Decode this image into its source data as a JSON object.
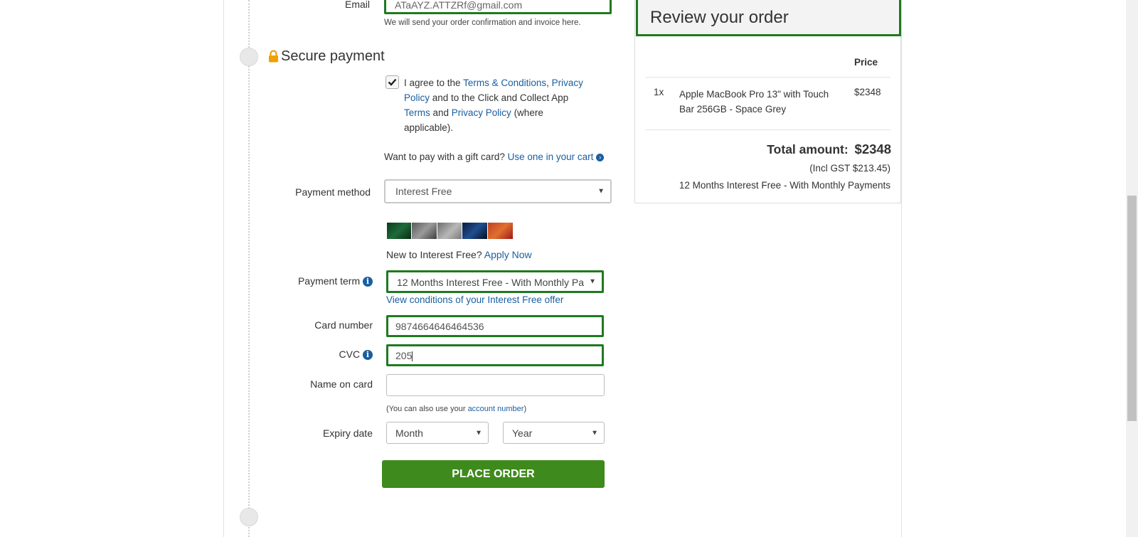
{
  "contact": {
    "email_label": "Email",
    "email_value": "ATaAYZ.ATTZRf@gmail.com",
    "email_note": "We will send your order confirmation and invoice here."
  },
  "payment": {
    "section_title": "Secure payment",
    "terms_checked": true,
    "terms_text_1": "I agree to the ",
    "terms_link_1": "Terms & Conditions",
    "terms_text_2": ", ",
    "terms_link_2": "Privacy Policy",
    "terms_text_3": " and to the Click and Collect App ",
    "terms_link_3": "Terms",
    "terms_text_4": " and ",
    "terms_link_4": "Privacy Policy",
    "terms_text_5": " (where applicable).",
    "gift_text": "Want to pay with a gift card?",
    "gift_link": "Use one in your cart",
    "method_label": "Payment method",
    "method_value": "Interest Free",
    "new_text": "New to Interest Free?",
    "apply_link": "Apply Now",
    "term_label": "Payment term",
    "term_value": "12 Months Interest Free - With Monthly Pa",
    "conditions_link": "View conditions of your Interest Free offer",
    "card_label": "Card number",
    "card_value": "9874664646464536",
    "cvc_label": "CVC",
    "cvc_value": "205",
    "name_label": "Name on card",
    "name_value": "",
    "hint_text_1": "(You can also use your ",
    "hint_link": "account number",
    "hint_text_2": ")",
    "expiry_label": "Expiry date",
    "month_value": "Month",
    "year_value": "Year",
    "place_order": "PLACE ORDER"
  },
  "review": {
    "title": "Review your order",
    "price_header": "Price",
    "items": [
      {
        "qty": "1x",
        "name": "Apple MacBook Pro 13\" with Touch Bar 256GB - Space Grey",
        "price": "$2348"
      }
    ],
    "total_label": "Total amount:",
    "total_value": "$2348",
    "gst": "(Incl GST $213.45)",
    "plan": "12 Months Interest Free - With Monthly Payments"
  },
  "colors": {
    "accent_green": "#1f7a1f",
    "button_green": "#3f8a1c",
    "link_blue": "#1a5fa0",
    "lock_orange": "#f0a000"
  }
}
